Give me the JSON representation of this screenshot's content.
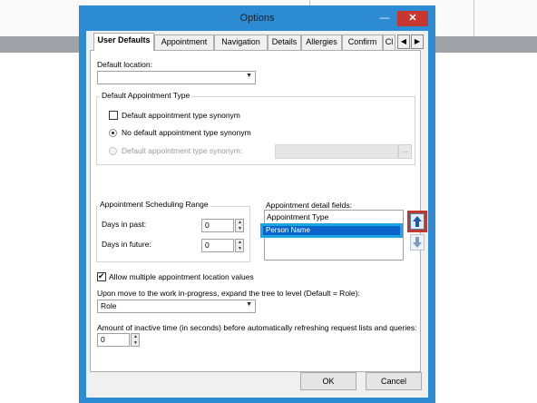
{
  "dialog": {
    "title": "Options",
    "minimize_icon": "minimize-icon",
    "close_icon": "close-icon",
    "close_glyph": "✕",
    "minimize_glyph": "—"
  },
  "tabs": [
    {
      "label": "User Defaults",
      "active": true
    },
    {
      "label": "Appointment"
    },
    {
      "label": "Navigation"
    },
    {
      "label": "Details"
    },
    {
      "label": "Allergies"
    },
    {
      "label": "Confirm"
    },
    {
      "label": "Cl"
    }
  ],
  "tab_scroll_glyph": "▶",
  "default_location": {
    "label": "Default location:",
    "value": ""
  },
  "default_appointment_type": {
    "title": "Default Appointment Type",
    "synonym_checkbox": {
      "label": "Default appointment type synonym",
      "checked": false
    },
    "radio_none": {
      "label": "No default appointment type synonym",
      "selected": true
    },
    "radio_default": {
      "label": "Default appointment type synonym:",
      "selected": false
    },
    "browse_label": "..."
  },
  "scheduling_range": {
    "title": "Appointment Scheduling Range",
    "days_past": {
      "label": "Days in past:",
      "value": "0"
    },
    "days_future": {
      "label": "Days in future:",
      "value": "0"
    }
  },
  "detail_fields": {
    "label": "Appointment detail fields:",
    "items": [
      {
        "label": "Appointment Type",
        "selected": false
      },
      {
        "label": "Person Name",
        "selected": true
      }
    ]
  },
  "allow_multiple": {
    "label": "Allow multiple appointment location values",
    "checked": true
  },
  "expand_tree": {
    "label": "Upon move to the work in-progress, expand the tree to level (Default = Role):",
    "value": "Role"
  },
  "inactive_time": {
    "label": "Amount of inactive time (in seconds) before automatically refreshing request lists and queries:",
    "value": "0"
  },
  "buttons": {
    "ok": "OK",
    "cancel": "Cancel"
  },
  "colors": {
    "window_border": "#2d8bd3",
    "close_button": "#c7372f",
    "selection": "#0a63c9",
    "highlight_outline": "#1aa6e0",
    "annotation_box": "#c0392b"
  }
}
